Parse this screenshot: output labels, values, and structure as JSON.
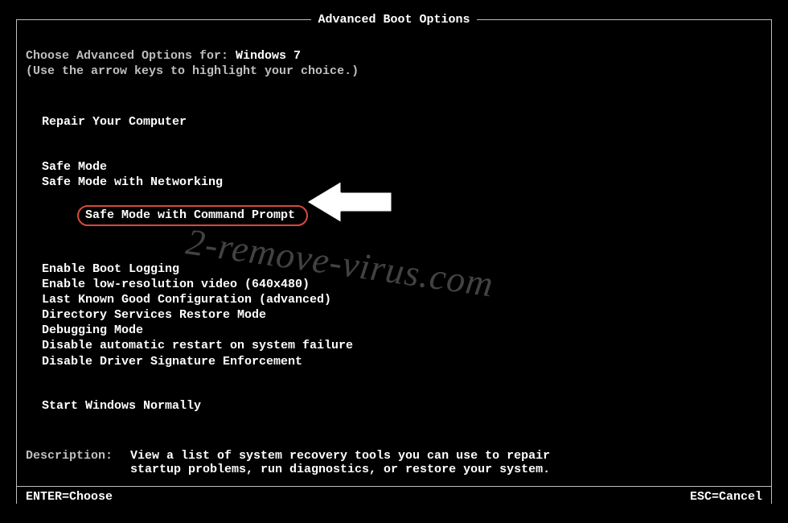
{
  "title": "Advanced Boot Options",
  "header": {
    "prefix": "Choose Advanced Options for: ",
    "os": "Windows 7",
    "hint": "(Use the arrow keys to highlight your choice.)"
  },
  "sections": {
    "repair": "Repair Your Computer",
    "safe": [
      "Safe Mode",
      "Safe Mode with Networking",
      "Safe Mode with Command Prompt"
    ],
    "advanced": [
      "Enable Boot Logging",
      "Enable low-resolution video (640x480)",
      "Last Known Good Configuration (advanced)",
      "Directory Services Restore Mode",
      "Debugging Mode",
      "Disable automatic restart on system failure",
      "Disable Driver Signature Enforcement"
    ],
    "normal": "Start Windows Normally"
  },
  "description": {
    "label": "Description:",
    "body": "View a list of system recovery tools you can use to repair startup problems, run diagnostics, or restore your system."
  },
  "footer": {
    "enter": "ENTER=Choose",
    "esc": "ESC=Cancel"
  },
  "watermark": "2-remove-virus.com"
}
